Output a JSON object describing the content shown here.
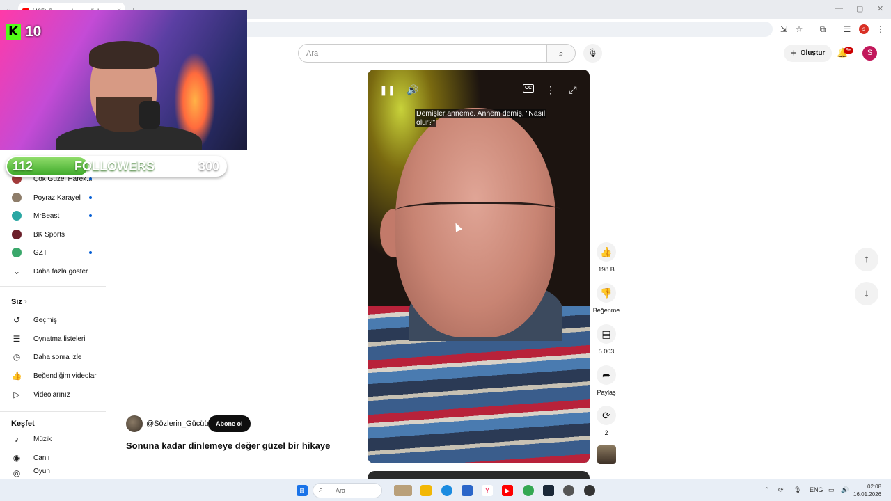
{
  "browser": {
    "tab_title": "(405) Sonuna kadar dinlem...",
    "new_tab": "+",
    "close": "×",
    "profile_initial": "s"
  },
  "masthead": {
    "search_placeholder": "Ara",
    "create_label": "Oluştur",
    "notif_badge": "9+",
    "avatar_initial": "S"
  },
  "overlay": {
    "kick_count": "10",
    "followers_current": "112",
    "followers_label": "FOLLOWERS",
    "followers_goal": "300",
    "followers_progress": 0.37
  },
  "sidebar": {
    "subscriptions": [
      {
        "label": "Çok Güzel Harek...",
        "color": "#a33b3b"
      },
      {
        "label": "Poyraz Karayel",
        "color": "#8e7d6a"
      },
      {
        "label": "MrBeast",
        "color": "#2aa7a3"
      },
      {
        "label": "BK Sports",
        "color": "#6b1f2a"
      },
      {
        "label": "GZT",
        "color": "#3aa86b"
      }
    ],
    "show_more": "Daha fazla göster",
    "you_header": "Siz",
    "you_items": [
      {
        "label": "Geçmiş",
        "icon": "history-icon"
      },
      {
        "label": "Oynatma listeleri",
        "icon": "playlists-icon"
      },
      {
        "label": "Daha sonra izle",
        "icon": "watch-later-icon"
      },
      {
        "label": "Beğendiğim videolar",
        "icon": "liked-icon"
      },
      {
        "label": "Videolarınız",
        "icon": "your-videos-icon"
      }
    ],
    "explore_header": "Keşfet",
    "explore_items": [
      {
        "label": "Müzik",
        "icon": "music-icon"
      },
      {
        "label": "Canlı",
        "icon": "live-icon"
      },
      {
        "label": "Oyun",
        "icon": "gaming-icon"
      }
    ]
  },
  "video": {
    "subtitle": "Demişler anneme. Annem demiş, \"Nasıl olur?\"",
    "channel": "@Sözlerin_Gücüü",
    "subscribe": "Abone ol",
    "title": "Sonuna kadar dinlemeye değer güzel bir hikaye",
    "likes": "198 B",
    "dislike_label": "Beğenme",
    "comments": "5.003",
    "share_label": "Paylaş",
    "remix_count": "2"
  },
  "taskbar": {
    "search_placeholder": "Ara",
    "language": "ENG",
    "time": "02:08",
    "date": "16.01.2026"
  }
}
